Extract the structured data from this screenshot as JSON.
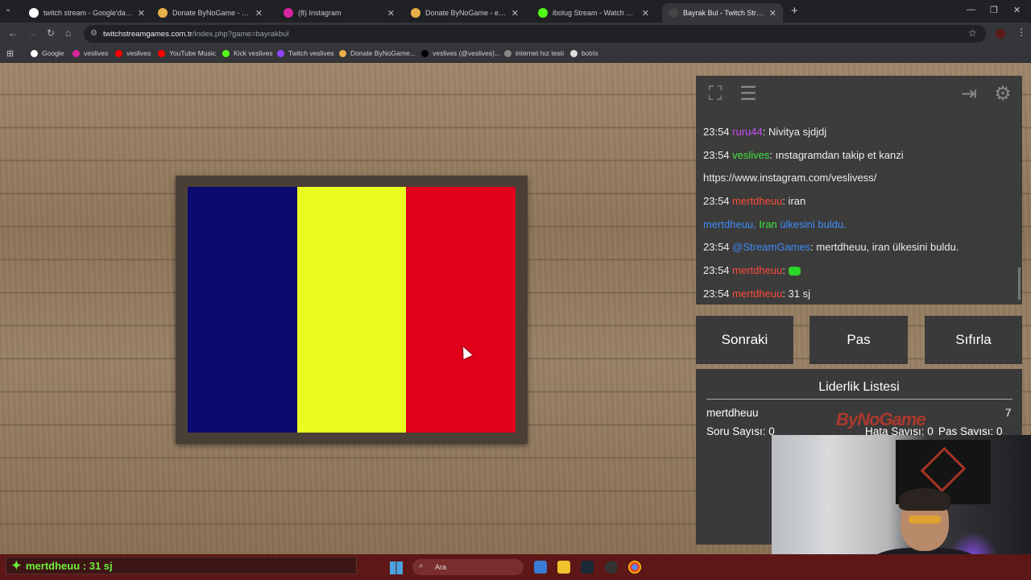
{
  "browser": {
    "tabs": [
      {
        "title": "twitch stream - Google'da Ara",
        "active": false,
        "favicon_color": "#ffffff"
      },
      {
        "title": "Donate ByNoGame - Gelen/Gid",
        "active": false,
        "favicon_color": "#e8b04a"
      },
      {
        "title": "(8) Instagram",
        "active": false,
        "favicon_color": "#d6249f"
      },
      {
        "title": "Donate ByNoGame - eceesu Do",
        "active": false,
        "favicon_color": "#e8b04a"
      },
      {
        "title": "ibolug Stream - Watch Live on",
        "active": false,
        "favicon_color": "#53fc18"
      },
      {
        "title": "Bayrak Bul - Twitch Stream",
        "active": true,
        "favicon_color": "#444"
      }
    ],
    "url_host": "twitchstreamgames.com.tr",
    "url_path": "/index.php?game=bayrakbul",
    "bookmarks": [
      {
        "label": "Google",
        "color": "#ffffff"
      },
      {
        "label": "veslives",
        "color": "#d6249f"
      },
      {
        "label": "veslives",
        "color": "#ff0000"
      },
      {
        "label": "YouTube Music",
        "color": "#ff0000"
      },
      {
        "label": "Kick veslives",
        "color": "#53fc18"
      },
      {
        "label": "Twitch veslives",
        "color": "#9146ff"
      },
      {
        "label": "Donate ByNoGame...",
        "color": "#e8b04a"
      },
      {
        "label": "veslives (@veslives)...",
        "color": "#000000"
      },
      {
        "label": "internet hız testi",
        "color": "#888888"
      },
      {
        "label": "botrix",
        "color": "#dddddd"
      }
    ]
  },
  "game": {
    "flag_colors": [
      "#0b0a6e",
      "#eafc1f",
      "#e0001b"
    ]
  },
  "chat": {
    "lines": [
      {
        "time": "23:54",
        "user": "ruru44",
        "user_color": "#c94cff",
        "text": ": Nivitya sjdjdj"
      },
      {
        "time": "23:54",
        "user": "veslives",
        "user_color": "#3de83d",
        "text": ": ınstagramdan takip et kanzi"
      },
      {
        "time": "",
        "user": "",
        "user_color": "#ffffff",
        "text": "https://www.instagram.com/veslivess/"
      },
      {
        "time": "23:54",
        "user": "mertdheuu",
        "user_color": "#ff4a3a",
        "text": ": iran"
      },
      {
        "time": "",
        "user": "mertdheuu,",
        "user_color": "#3b8cff",
        "text": " Iran",
        "extra": " ülkesini buldu."
      },
      {
        "time": "23:54",
        "user": "@StreamGames",
        "user_color": "#3b8cff",
        "text": ": mertdheuu, iran ülkesini buldu."
      },
      {
        "time": "23:54",
        "user": "mertdheuu",
        "user_color": "#ff4a3a",
        "text": ": ",
        "emote": true
      },
      {
        "time": "23:54",
        "user": "mertdheuu",
        "user_color": "#ff4a3a",
        "text": ": 31 sj"
      }
    ]
  },
  "controls": {
    "next_label": "Sonraki",
    "pass_label": "Pas",
    "reset_label": "Sıfırla"
  },
  "leaderboard": {
    "title": "Liderlik Listesi",
    "player": "mertdheuu",
    "score": "7",
    "questions": "Soru Sayısı: 0",
    "errors": "Hata Sayısı: 0",
    "passes": "Pas Sayısı: 0"
  },
  "overlay": {
    "brand": "ByNoGame"
  },
  "taskbar": {
    "alert": "mertdheuu : 31 sj",
    "search_placeholder": "Ara"
  }
}
